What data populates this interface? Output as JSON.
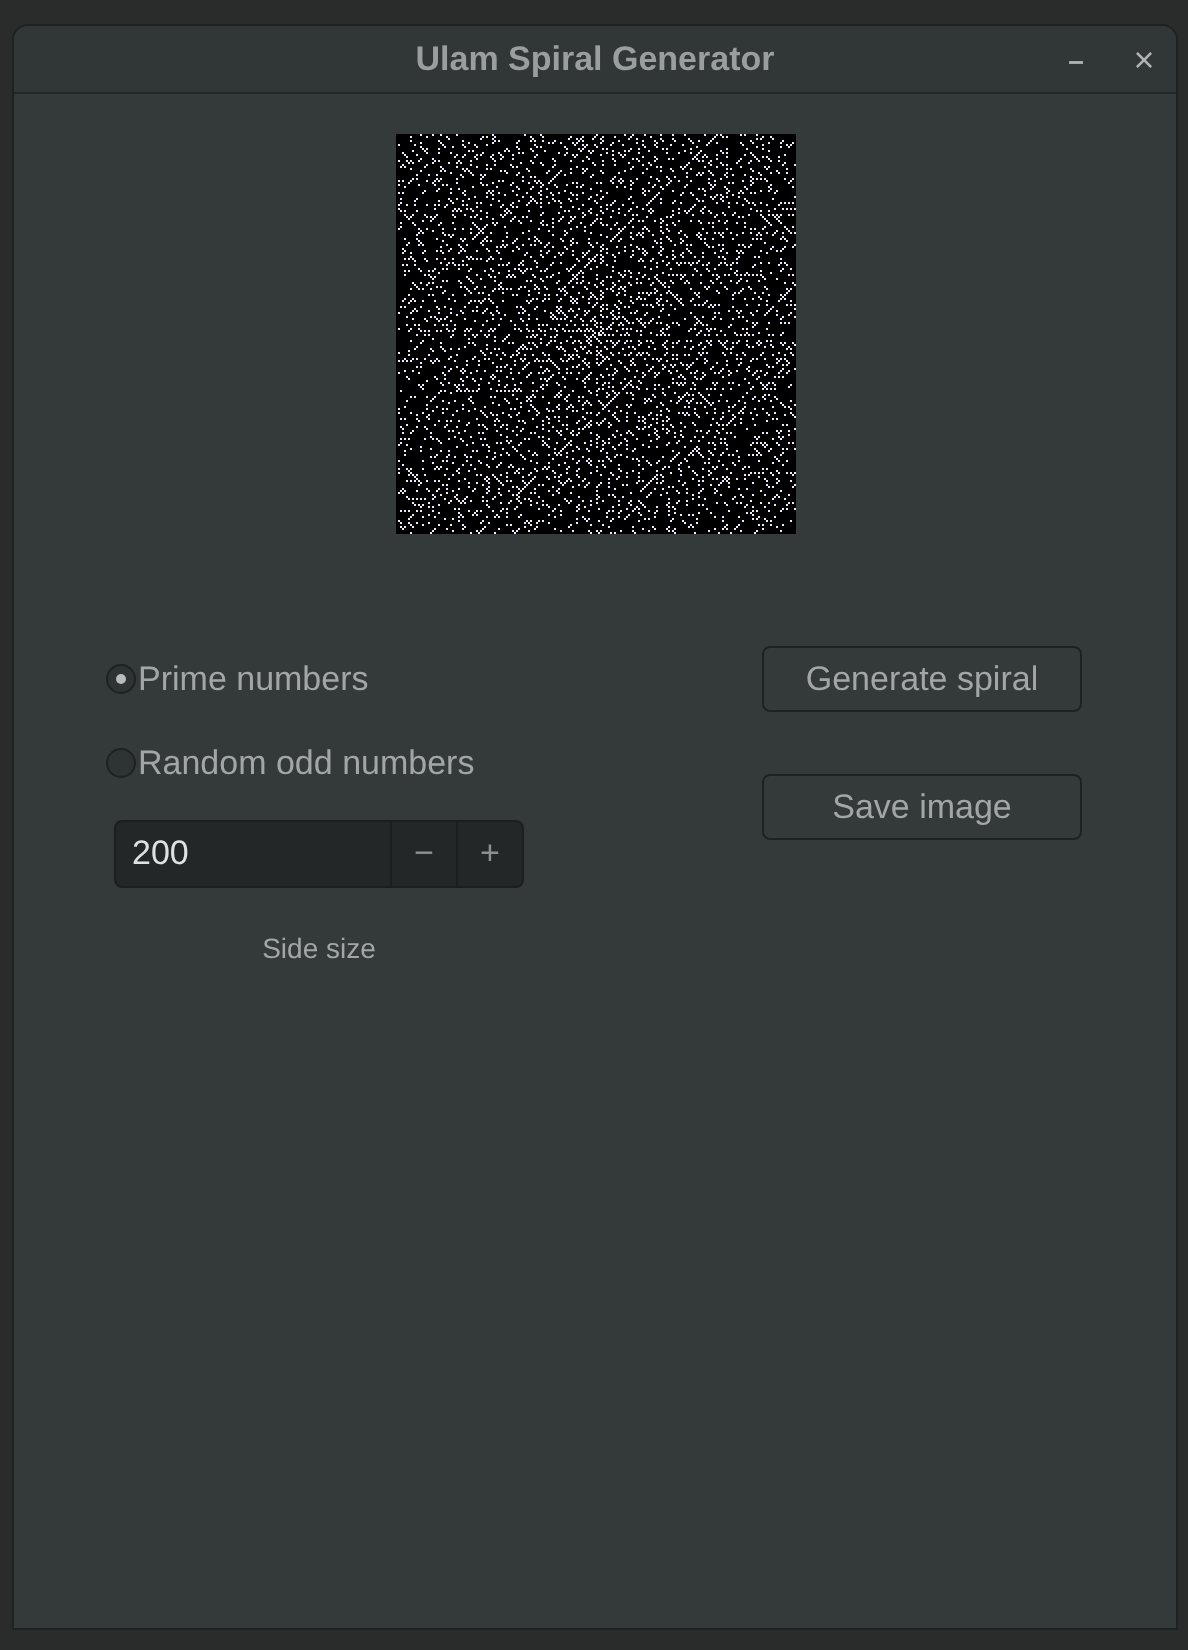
{
  "window": {
    "title": "Ulam Spiral Generator",
    "minimize": "–",
    "close": "×"
  },
  "options": [
    {
      "label": "Prime numbers",
      "selected": true
    },
    {
      "label": "Random odd numbers",
      "selected": false
    }
  ],
  "side_size": {
    "value": "200",
    "minus": "−",
    "plus": "+",
    "label": "Side size"
  },
  "buttons": [
    "Generate spiral",
    "Save image"
  ]
}
